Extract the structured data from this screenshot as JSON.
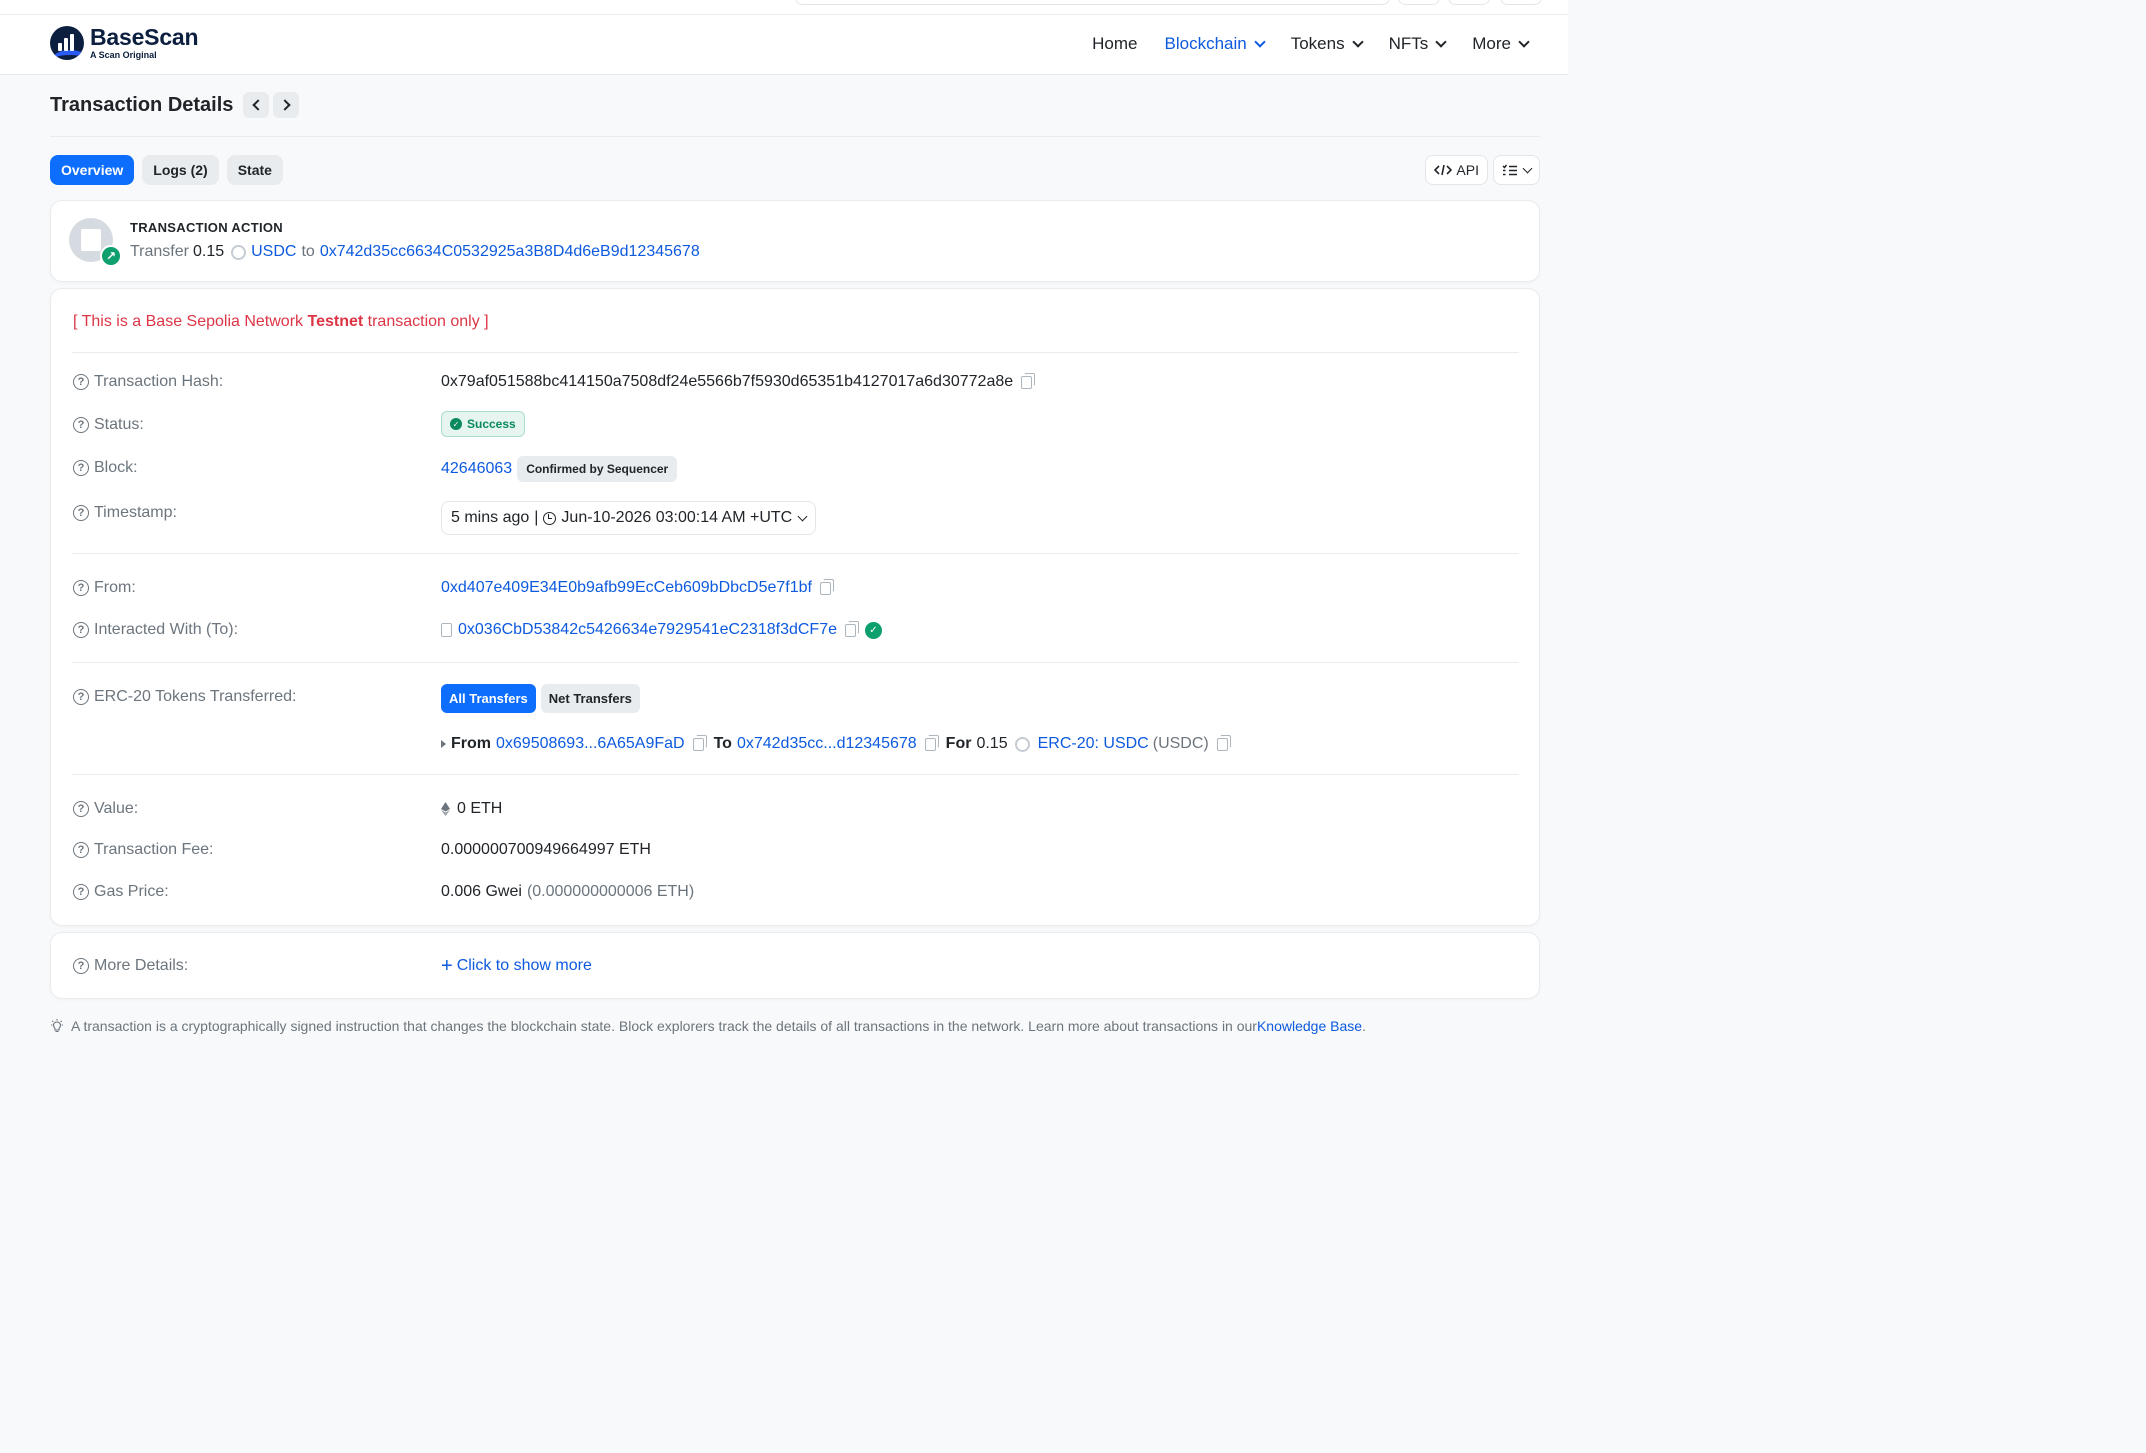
{
  "brand": {
    "name": "BaseScan",
    "tagline": "A Scan Original"
  },
  "nav": {
    "items": [
      {
        "label": "Home",
        "active": false,
        "dropdown": false
      },
      {
        "label": "Blockchain",
        "active": true,
        "dropdown": true
      },
      {
        "label": "Tokens",
        "active": false,
        "dropdown": true
      },
      {
        "label": "NFTs",
        "active": false,
        "dropdown": true
      },
      {
        "label": "More",
        "active": false,
        "dropdown": true
      }
    ]
  },
  "page": {
    "title": "Transaction Details"
  },
  "tabs": [
    {
      "label": "Overview",
      "active": true
    },
    {
      "label": "Logs (2)",
      "active": false
    },
    {
      "label": "State",
      "active": false
    }
  ],
  "tools": {
    "api_label": "API"
  },
  "action": {
    "heading": "TRANSACTION ACTION",
    "verb": "Transfer",
    "amount": "0.15",
    "token": "USDC",
    "to_word": "to",
    "to_address": "0x742d35cc6634C0532925a3B8D4d6eB9d12345678"
  },
  "testnet_notice": {
    "prefix": "[ This is a Base Sepolia Network ",
    "bold": "Testnet",
    "suffix": " transaction only ]"
  },
  "details": {
    "hash": {
      "label": "Transaction Hash:",
      "value": "0x79af051588bc414150a7508df24e5566b7f5930d65351b4127017a6d30772a8e"
    },
    "status": {
      "label": "Status:",
      "value": "Success"
    },
    "block": {
      "label": "Block:",
      "value": "42646063",
      "badge": "Confirmed by Sequencer"
    },
    "timestamp": {
      "label": "Timestamp:",
      "ago": "5 mins ago",
      "sep": "|",
      "value": "Jun-10-2026 03:00:14 AM +UTC"
    },
    "from": {
      "label": "From:",
      "value": "0xd407e409E34E0b9afb99EcCeb609bDbcD5e7f1bf"
    },
    "to": {
      "label": "Interacted With (To):",
      "value": "0x036CbD53842c5426634e7929541eC2318f3dCF7e"
    },
    "erc20": {
      "label": "ERC-20 Tokens Transferred:",
      "tab_all": "All Transfers",
      "tab_net": "Net Transfers",
      "from_word": "From",
      "from_addr": "0x69508693...6A65A9FaD",
      "to_word": "To",
      "to_addr": "0x742d35cc...d12345678",
      "for_word": "For",
      "amount": "0.15",
      "token_link": "ERC-20: USDC",
      "token_symbol": "(USDC)"
    },
    "value": {
      "label": "Value:",
      "value": "0 ETH"
    },
    "fee": {
      "label": "Transaction Fee:",
      "value": "0.000000700949664997 ETH"
    },
    "gas": {
      "label": "Gas Price:",
      "value": "0.006 Gwei",
      "eth": "(0.000000000006 ETH)"
    }
  },
  "more": {
    "label": "More Details:",
    "link": "Click to show more",
    "plus": "+"
  },
  "footer": {
    "text": "A transaction is a cryptographically signed instruction that changes the blockchain state. Block explorers track the details of all transactions in the network. Learn more about transactions in our ",
    "link": "Knowledge Base",
    "end": "."
  },
  "colors": {
    "accent": "#0d6efd",
    "link": "#0d5adf",
    "success": "#0e9f6e",
    "danger": "#dc3545"
  }
}
